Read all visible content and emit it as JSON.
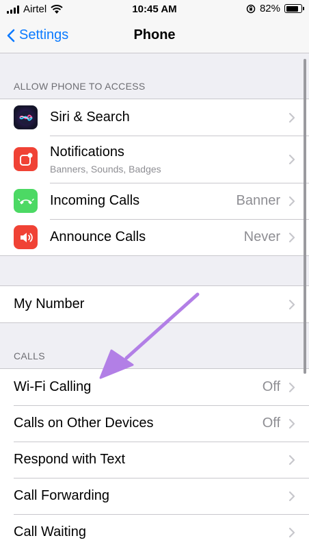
{
  "status_bar": {
    "carrier": "Airtel",
    "time": "10:45 AM",
    "battery_percent": "82%",
    "battery_level": 0.82
  },
  "nav": {
    "back_label": "Settings",
    "title": "Phone"
  },
  "sections": {
    "allow_access": {
      "header": "ALLOW PHONE TO ACCESS",
      "items": [
        {
          "label": "Siri & Search",
          "icon": "siri-icon"
        },
        {
          "label": "Notifications",
          "subtitle": "Banners, Sounds, Badges",
          "icon": "notifications-icon"
        },
        {
          "label": "Incoming Calls",
          "value": "Banner",
          "icon": "incoming-calls-icon"
        },
        {
          "label": "Announce Calls",
          "value": "Never",
          "icon": "announce-calls-icon"
        }
      ]
    },
    "my_number": {
      "label": "My Number"
    },
    "calls": {
      "header": "CALLS",
      "items": [
        {
          "label": "Wi-Fi Calling",
          "value": "Off"
        },
        {
          "label": "Calls on Other Devices",
          "value": "Off"
        },
        {
          "label": "Respond with Text"
        },
        {
          "label": "Call Forwarding"
        },
        {
          "label": "Call Waiting"
        }
      ]
    }
  },
  "colors": {
    "accent": "#0a7aff",
    "annotation_arrow": "#b27fe6",
    "notifications_icon": "#f04235",
    "incoming_calls_icon": "#4cd964",
    "announce_calls_icon": "#f04235"
  }
}
